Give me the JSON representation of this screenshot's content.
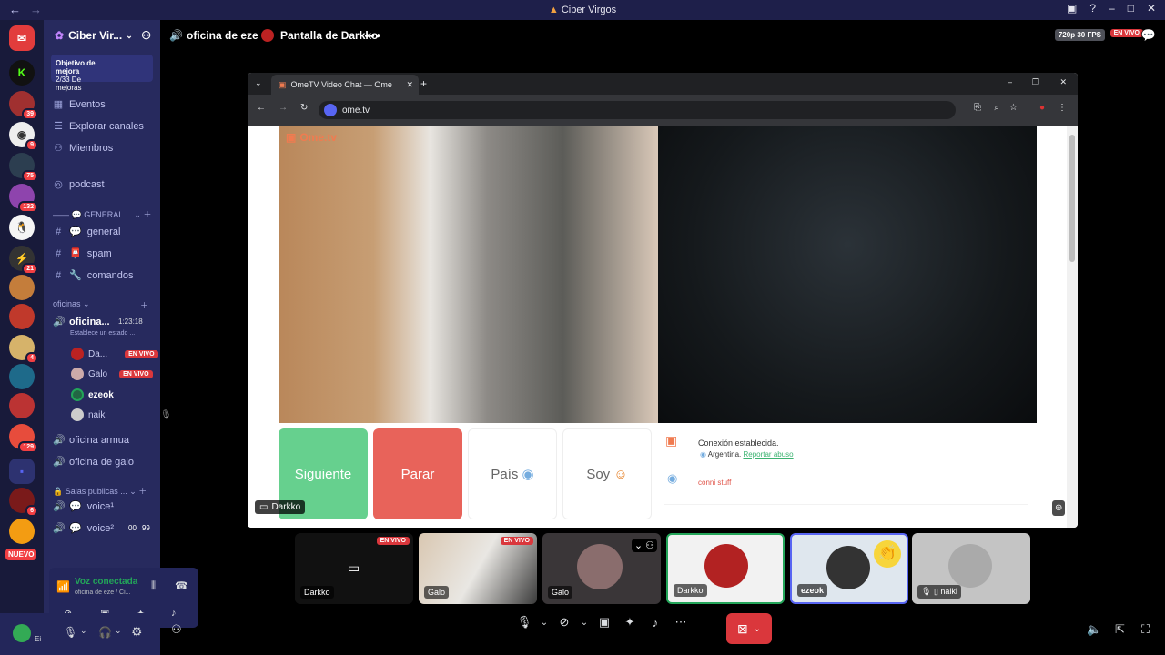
{
  "window": {
    "title": "Ciber Virgos"
  },
  "servers": {
    "badges": [
      "39",
      "9",
      "75",
      "132",
      "21",
      "4",
      "129",
      "6"
    ],
    "nuevo": "NUEVO"
  },
  "server": {
    "name": "Ciber Vir...",
    "boost_label": "Objetivo de mejora",
    "boost_count": "2/33 De mejoras",
    "menu": [
      "Eventos",
      "Explorar canales",
      "Miembros"
    ],
    "podcast": "podcast",
    "general_cat": "GENERAL ...",
    "text_channels": [
      "general",
      "spam",
      "comandos"
    ],
    "oficinas_cat": "oficinas",
    "active_voice": "oficina...",
    "active_timer": "1:23:18",
    "active_status": "Establece un estado ...",
    "voice_users": [
      {
        "name": "Da...",
        "live": "EN VIVO"
      },
      {
        "name": "Galo",
        "live": "EN VIVO"
      },
      {
        "name": "ezeok",
        "live": ""
      },
      {
        "name": "naiki",
        "live": ""
      }
    ],
    "other_voice": [
      "oficina armua",
      "oficina de galo"
    ],
    "public_cat": "Salas publicas ...",
    "voice_rooms": [
      {
        "name": "voice¹",
        "a": "",
        "b": ""
      },
      {
        "name": "voice²",
        "a": "00",
        "b": "99"
      }
    ]
  },
  "voice_panel": {
    "status": "Voz conectada",
    "sub": "oficina de eze / Ci..."
  },
  "userbar": {
    "name": "Ei"
  },
  "stage": {
    "channel": "oficina de eze",
    "screen_title": "Pantalla de Darkko",
    "quality": "720p 30 FPS",
    "live": "EN VIVO"
  },
  "browser": {
    "tab_title": "OmeTV Video Chat — Ome",
    "url": "ome.tv",
    "logo": "Ome.tv",
    "btn_next": "Siguiente",
    "btn_stop": "Parar",
    "btn_country": "País",
    "btn_gender": "Soy",
    "chat_connected": "Conexión establecida.",
    "chat_country": "Argentina.",
    "chat_report": "Reportar abuso",
    "chat_msg": "conni stuff"
  },
  "screen_caption": "Darkko",
  "participants": [
    {
      "name": "Darkko",
      "live": "EN VIVO"
    },
    {
      "name": "Galo",
      "live": "EN VIVO"
    },
    {
      "name": "Galo",
      "live": ""
    },
    {
      "name": "Darkko",
      "live": ""
    },
    {
      "name": "ezeok",
      "live": ""
    },
    {
      "name": "naiki",
      "live": ""
    }
  ]
}
